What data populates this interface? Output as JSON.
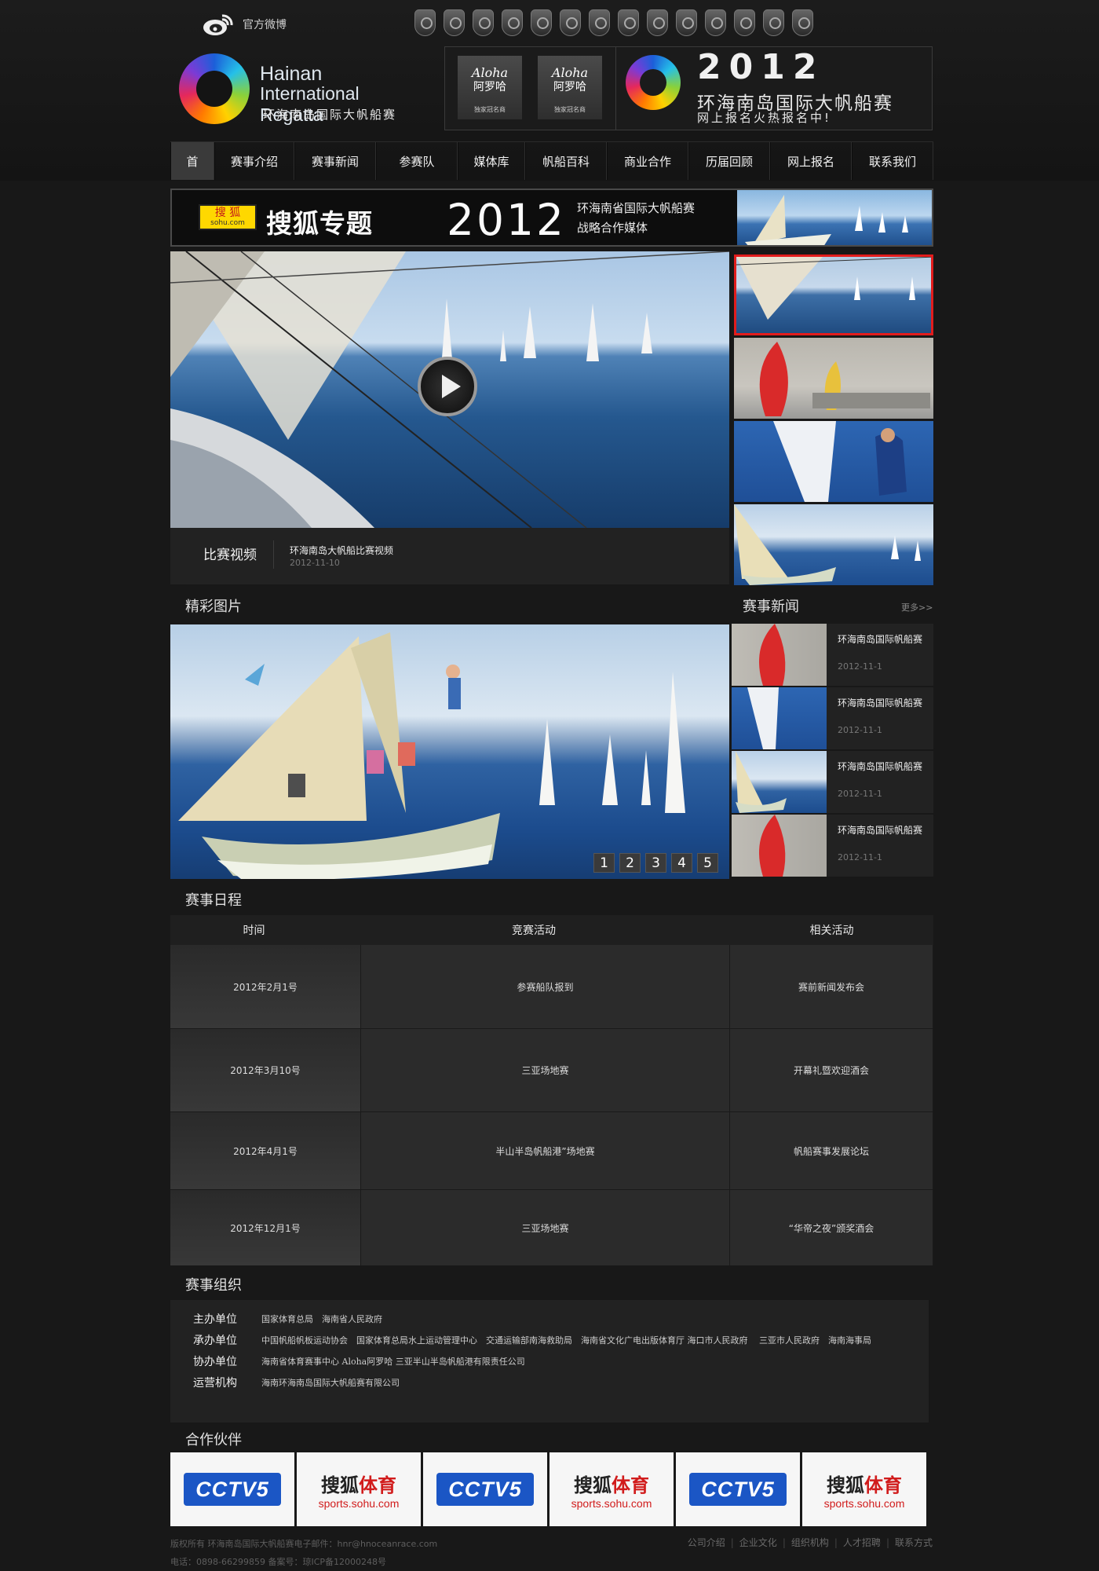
{
  "weibo": {
    "label": "官方微博"
  },
  "logo": {
    "line1": "Hainan",
    "line2": "International Regatta",
    "line3": "环海南岛国际大帆船赛"
  },
  "header_promo": {
    "sponsor_script": "Aloha",
    "sponsor_cn": "阿罗哈",
    "sponsor_tag": "独家冠名商",
    "year": "2012",
    "name": "环海南岛国际大帆船赛",
    "sub": "网上报名火热报名中!"
  },
  "nav": {
    "items": [
      {
        "label": "首",
        "active": true
      },
      {
        "label": "赛事介绍"
      },
      {
        "label": "赛事新闻"
      },
      {
        "label": "参赛队"
      },
      {
        "label": "媒体库"
      },
      {
        "label": "帆船百科"
      },
      {
        "label": "商业合作"
      },
      {
        "label": "历届回顾"
      },
      {
        "label": "网上报名"
      },
      {
        "label": "联系我们"
      }
    ]
  },
  "sohu_banner": {
    "logo_cn": "搜 狐",
    "logo_en": "sohu.com",
    "title": "搜狐专题",
    "year": "2012",
    "line1": "环海南省国际大帆船赛",
    "line2": "战略合作媒体"
  },
  "video": {
    "label": "比赛视频",
    "title": "环海南岛大帆船比赛视频",
    "date": "2012-11-10"
  },
  "sections": {
    "gallery": "精彩图片",
    "news": "赛事新闻",
    "more": "更多>>",
    "schedule": "赛事日程",
    "org": "赛事组织",
    "partners": "合作伙伴"
  },
  "gallery": {
    "pages": [
      "1",
      "2",
      "3",
      "4",
      "5"
    ]
  },
  "news": [
    {
      "title": "环海南岛国际帆船赛",
      "date": "2012-11-1"
    },
    {
      "title": "环海南岛国际帆船赛",
      "date": "2012-11-1"
    },
    {
      "title": "环海南岛国际帆船赛",
      "date": "2012-11-1"
    },
    {
      "title": "环海南岛国际帆船赛",
      "date": "2012-11-1"
    }
  ],
  "schedule": {
    "headers": [
      "时间",
      "竞赛活动",
      "相关活动"
    ],
    "rows": [
      [
        "2012年2月1号",
        "参赛船队报到",
        "赛前新闻发布会"
      ],
      [
        "2012年3月10号",
        "三亚场地赛",
        "开幕礼暨欢迎酒会"
      ],
      [
        "2012年4月1号",
        "半山半岛帆船港”场地赛",
        "帆船赛事发展论坛"
      ],
      [
        "2012年12月1号",
        "三亚场地赛",
        "“华帝之夜”颁奖酒会"
      ]
    ]
  },
  "org": {
    "rows": [
      {
        "label": "主办单位",
        "value": "国家体育总局　海南省人民政府"
      },
      {
        "label": "承办单位",
        "value": "中国帆船帆板运动协会　国家体育总局水上运动管理中心　交通运输部南海救助局　海南省文化广电出版体育厅 海口市人民政府　 三亚市人民政府　海南海事局"
      },
      {
        "label": "协办单位",
        "value": "海南省体育赛事中心 Aloha阿罗哈 三亚半山半岛帆船港有限责任公司"
      },
      {
        "label": "运营机构",
        "value": "海南环海南岛国际大帆船赛有限公司"
      }
    ]
  },
  "partners": [
    {
      "type": "cctv",
      "text": "CCTV5"
    },
    {
      "type": "sohu",
      "big1": "搜狐",
      "big2": "体育",
      "url": "sports.sohu.com"
    },
    {
      "type": "cctv",
      "text": "CCTV5"
    },
    {
      "type": "sohu",
      "big1": "搜狐",
      "big2": "体育",
      "url": "sports.sohu.com"
    },
    {
      "type": "cctv",
      "text": "CCTV5"
    },
    {
      "type": "sohu",
      "big1": "搜狐",
      "big2": "体育",
      "url": "sports.sohu.com"
    }
  ],
  "footer": {
    "line1": "版权所有 环海南岛国际大帆船赛电子邮件：hnr@hnoceanrace.com",
    "line2": "电话：0898-66299859 备案号：琼ICP备12000248号",
    "links": [
      "公司介绍",
      "企业文化",
      "组织机构",
      "人才招聘",
      "联系方式"
    ]
  }
}
